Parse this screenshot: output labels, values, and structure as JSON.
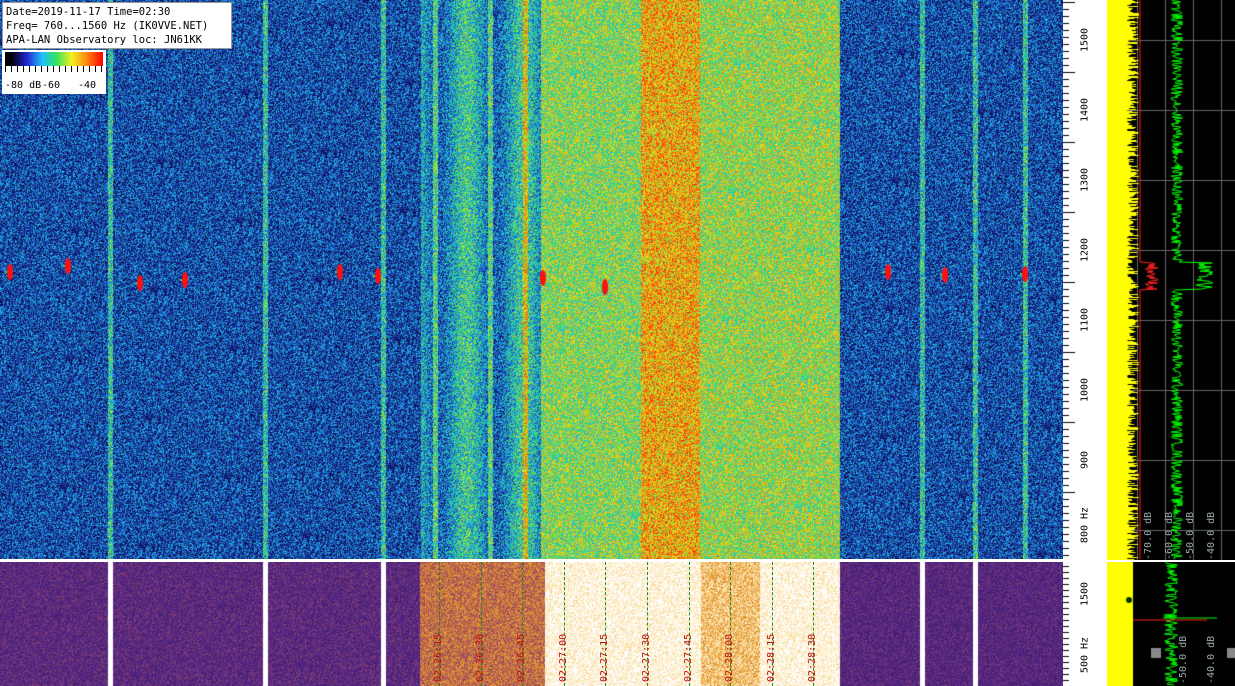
{
  "info": {
    "line1": "Date=2019-11-17 Time=02:30",
    "line2": "Freq= 760...1560 Hz (IK0VVE.NET)",
    "line3": "APA-LAN Observatory loc: JN61KK"
  },
  "colorbar": {
    "labels": [
      "-80 dB",
      "-60",
      "-40"
    ]
  },
  "freq_axis_top": {
    "ticks": [
      "1500",
      "1400",
      "1300",
      "1200",
      "1100",
      "1000",
      "900",
      "800 Hz"
    ],
    "values": [
      1500,
      1400,
      1300,
      1200,
      1100,
      1000,
      900,
      800
    ],
    "range_hz": [
      760,
      1560
    ]
  },
  "freq_axis_bottom": {
    "ticks": [
      "1500",
      "500 Hz"
    ]
  },
  "spectrum_top": {
    "db_labels": [
      "-70.0 dB",
      "-60.0 dB",
      "-50.0 dB",
      "-40.0 dB"
    ]
  },
  "spectrum_bottom": {
    "db_labels": [
      "-50.0 dB",
      "-40.0 dB"
    ]
  },
  "timeline": {
    "labels": [
      "02:26:15",
      "02:26:30",
      "02:26:45",
      "02:27:00",
      "02:27:15",
      "02:27:30",
      "02:27:45",
      "02:28:00",
      "02:28:15",
      "02:28:30"
    ]
  },
  "colors": {
    "background": "#000000",
    "spectrum_yellow": "#ffff00",
    "spectrum_green": "#00ff00",
    "spectrum_red": "#ff0000",
    "time_label": "#c01010",
    "marker": "#1f8a1f"
  }
}
